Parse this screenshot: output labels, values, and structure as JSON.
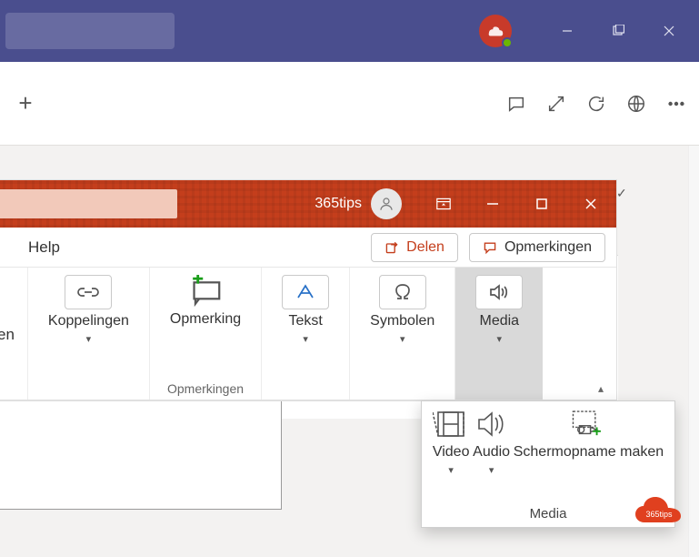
{
  "teams": {
    "window_controls": {
      "minimize": "–",
      "maximize": "❐",
      "close": "✕"
    }
  },
  "ppt": {
    "user_name": "365tips",
    "cmdbar": {
      "help": "Help",
      "share": "Delen",
      "comments": "Opmerkingen"
    },
    "ribbon": {
      "partial_left": "en",
      "links": "Koppelingen",
      "comment": "Opmerking",
      "comment_group": "Opmerkingen",
      "text": "Tekst",
      "symbols": "Symbolen",
      "media": "Media"
    }
  },
  "media_panel": {
    "video": "Video",
    "audio": "Audio",
    "screen_recording": "Schermopname maken",
    "footer": "Media"
  },
  "badge": "365tips"
}
